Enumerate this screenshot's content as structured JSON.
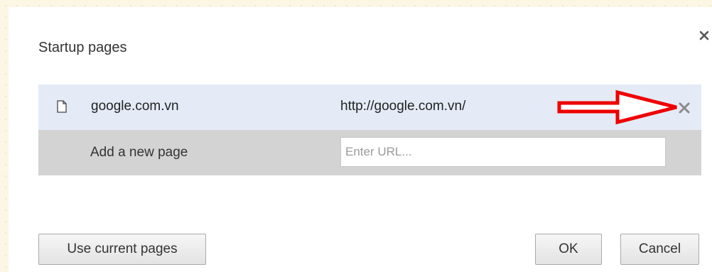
{
  "dialog": {
    "title": "Startup pages"
  },
  "pages": [
    {
      "name": "google.com.vn",
      "url": "http://google.com.vn/"
    }
  ],
  "add_page": {
    "label": "Add a new page",
    "input_value": "",
    "input_placeholder": "Enter URL..."
  },
  "buttons": {
    "use_current": "Use current pages",
    "ok": "OK",
    "cancel": "Cancel"
  },
  "icons": {
    "close": "close-icon",
    "page": "page-icon",
    "remove": "remove-icon",
    "annotation": "red-arrow-annotation"
  },
  "colors": {
    "selected_row": "#e4ebf7",
    "add_row": "#d3d3d3",
    "annotation_arrow": "#ee0000"
  }
}
